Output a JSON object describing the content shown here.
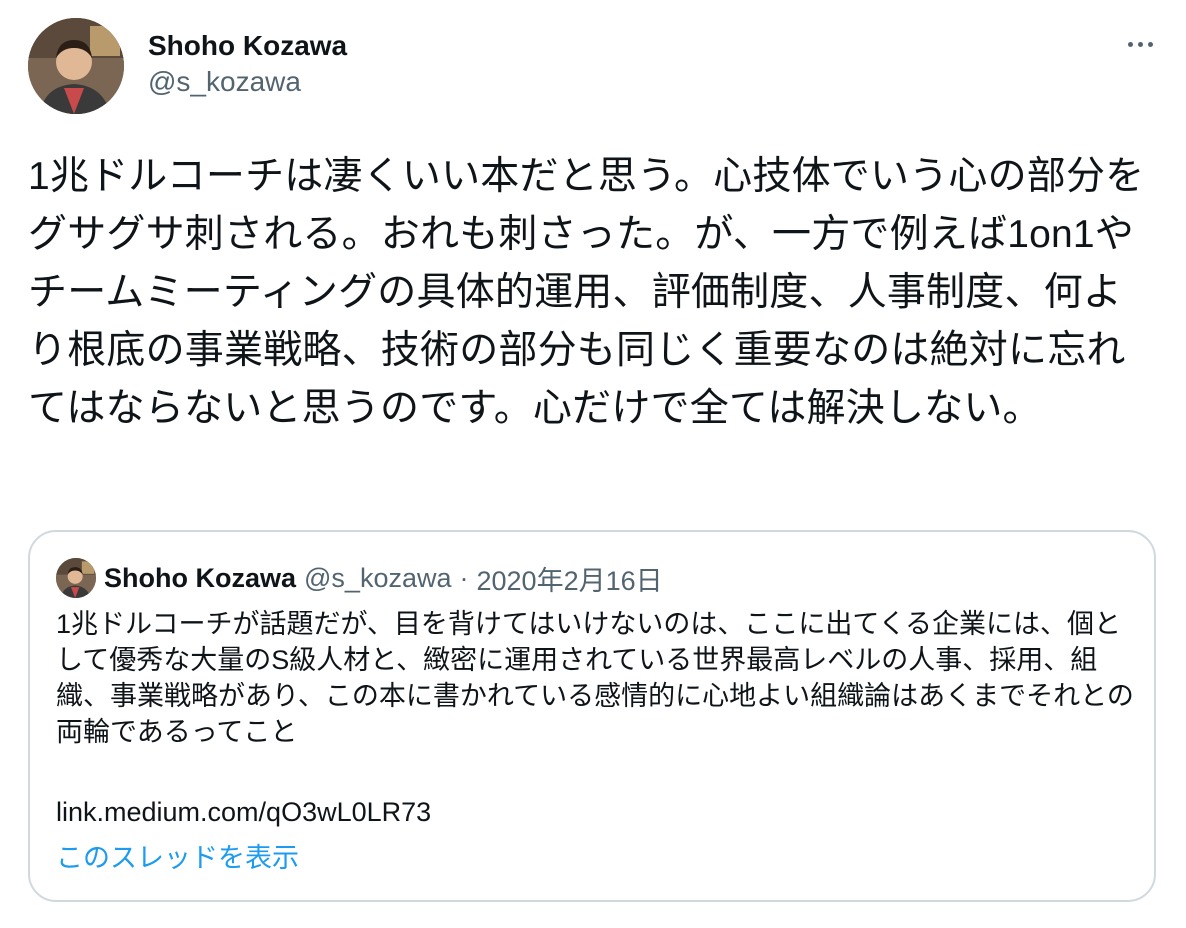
{
  "tweet": {
    "author": {
      "display_name": "Shoho Kozawa",
      "handle": "@s_kozawa"
    },
    "more_icon": "more-horizontal-icon",
    "text": "1兆ドルコーチは凄くいい本だと思う。心技体でいう心の部分をグサグサ刺される。おれも刺さった。が、一方で例えば1on1やチームミーティングの具体的運用、評価制度、人事制度、何より根底の事業戦略、技術の部分も同じく重要なのは絶対に忘れてはならないと思うのです。心だけで全ては解決しない。"
  },
  "quoted_tweet": {
    "author": {
      "display_name": "Shoho Kozawa",
      "handle": "@s_kozawa"
    },
    "separator": "·",
    "date": "2020年2月16日",
    "text": "1兆ドルコーチが話題だが、目を背けてはいけないのは、ここに出てくる企業には、個として優秀な大量のS級人材と、緻密に運用されている世界最高レベルの人事、採用、組織、事業戦略があり、この本に書かれている感情的に心地よい組織論はあくまでそれとの両輪であるってこと",
    "link": "link.medium.com/qO3wL0LR73",
    "show_thread": "このスレッドを表示"
  },
  "colors": {
    "text_primary": "#0f1419",
    "text_secondary": "#536471",
    "link_blue": "#1d9bf0",
    "border": "#cfd9de"
  }
}
